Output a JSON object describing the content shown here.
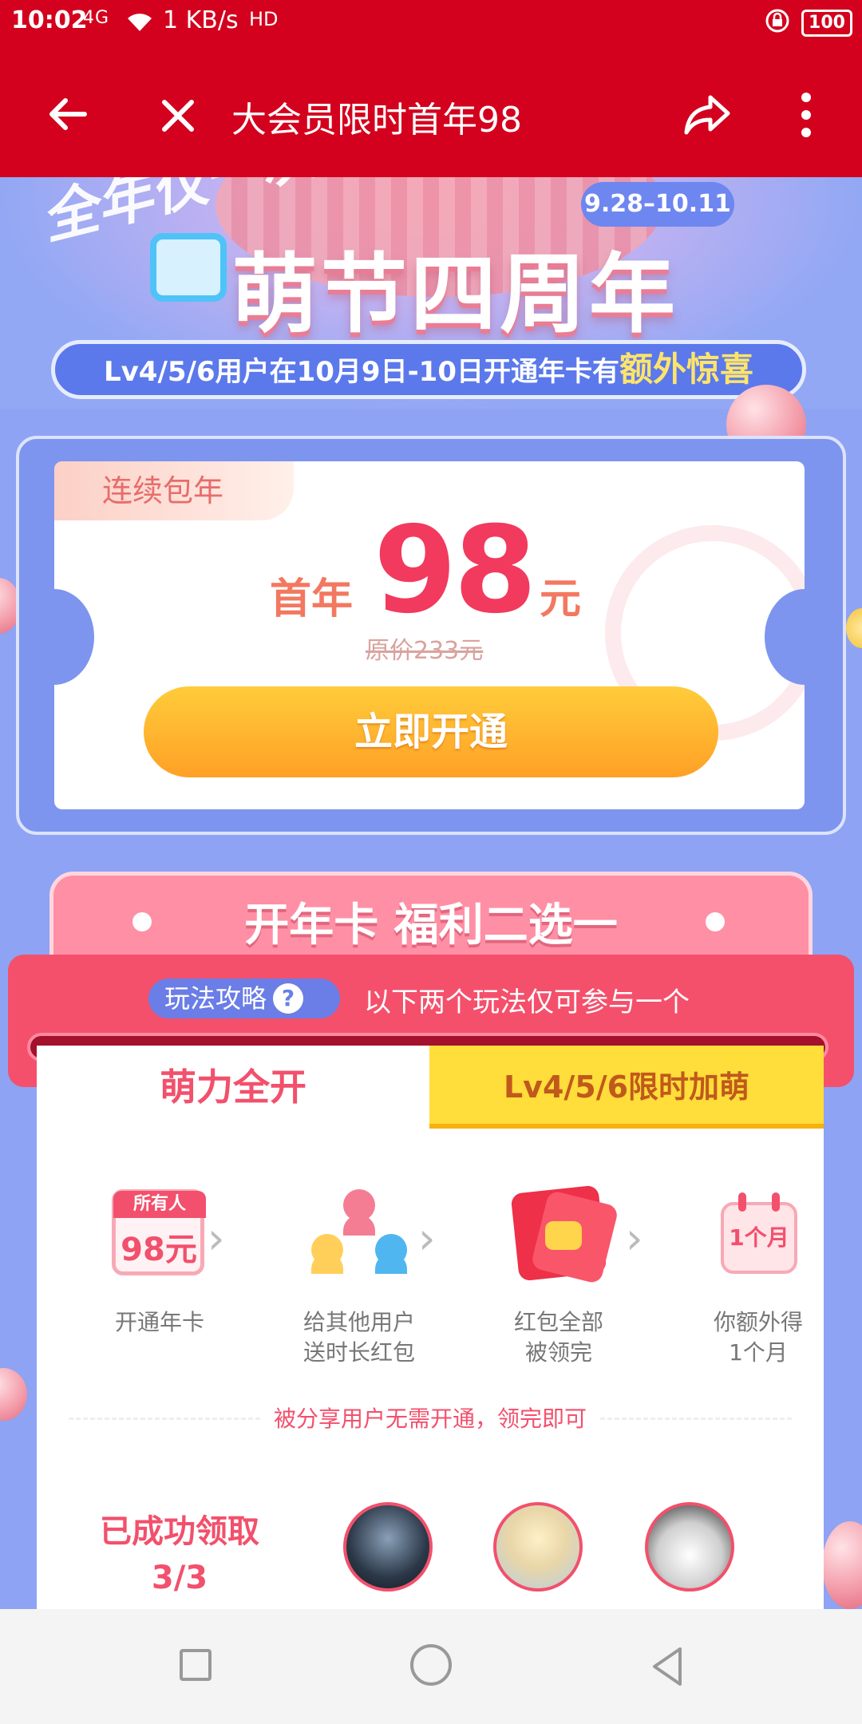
{
  "status_bar": {
    "time": "10:02",
    "network": "4G",
    "speed": "1 KB/s",
    "hd": "HD",
    "battery": "100"
  },
  "app_bar": {
    "title": "大会员限时首年98",
    "icons": [
      "back-arrow-icon",
      "close-icon",
      "share-icon",
      "more-vert-icon"
    ]
  },
  "banner": {
    "slogan": "全年仅一次",
    "heading": "萌节四周年",
    "date_range": "9.28–10.11",
    "strip_text": "Lv4/5/6用户在10月9日-10日开通年卡有",
    "strip_highlight": "额外惊喜"
  },
  "ticket": {
    "tag": "连续包年",
    "price_prefix": "首年",
    "price": "98",
    "price_unit": "元",
    "original_price": "原价233元",
    "button_label": "立即开通"
  },
  "section": {
    "title": "开年卡 福利二选一",
    "guide_label": "玩法攻略",
    "guide_icon": "?",
    "note": "以下两个玩法仅可参与一个"
  },
  "tabs": [
    {
      "label": "萌力全开",
      "active": true
    },
    {
      "label": "Lv4/5/6限时加萌",
      "active": false
    }
  ],
  "steps": [
    {
      "label": "开通年卡",
      "icon": "year-card-icon",
      "badge": "所有人",
      "price": "98元"
    },
    {
      "label": "给其他用户\n送时长红包",
      "icon": "users-share-icon"
    },
    {
      "label": "红包全部\n被领完",
      "icon": "red-envelope-icon"
    },
    {
      "label": "你额外得\n1个月",
      "icon": "calendar-icon",
      "badge": "1个月"
    }
  ],
  "share_note": "被分享用户无需开通，领完即可",
  "claimed": {
    "label": "已成功领取",
    "count": "3/3"
  },
  "colors": {
    "app_bar": "#D3011D",
    "accent_pink": "#F2506C",
    "button_gold": "#FFB22E",
    "tab_yellow": "#FFDD3A",
    "background_blue": "#8EA3F3"
  }
}
